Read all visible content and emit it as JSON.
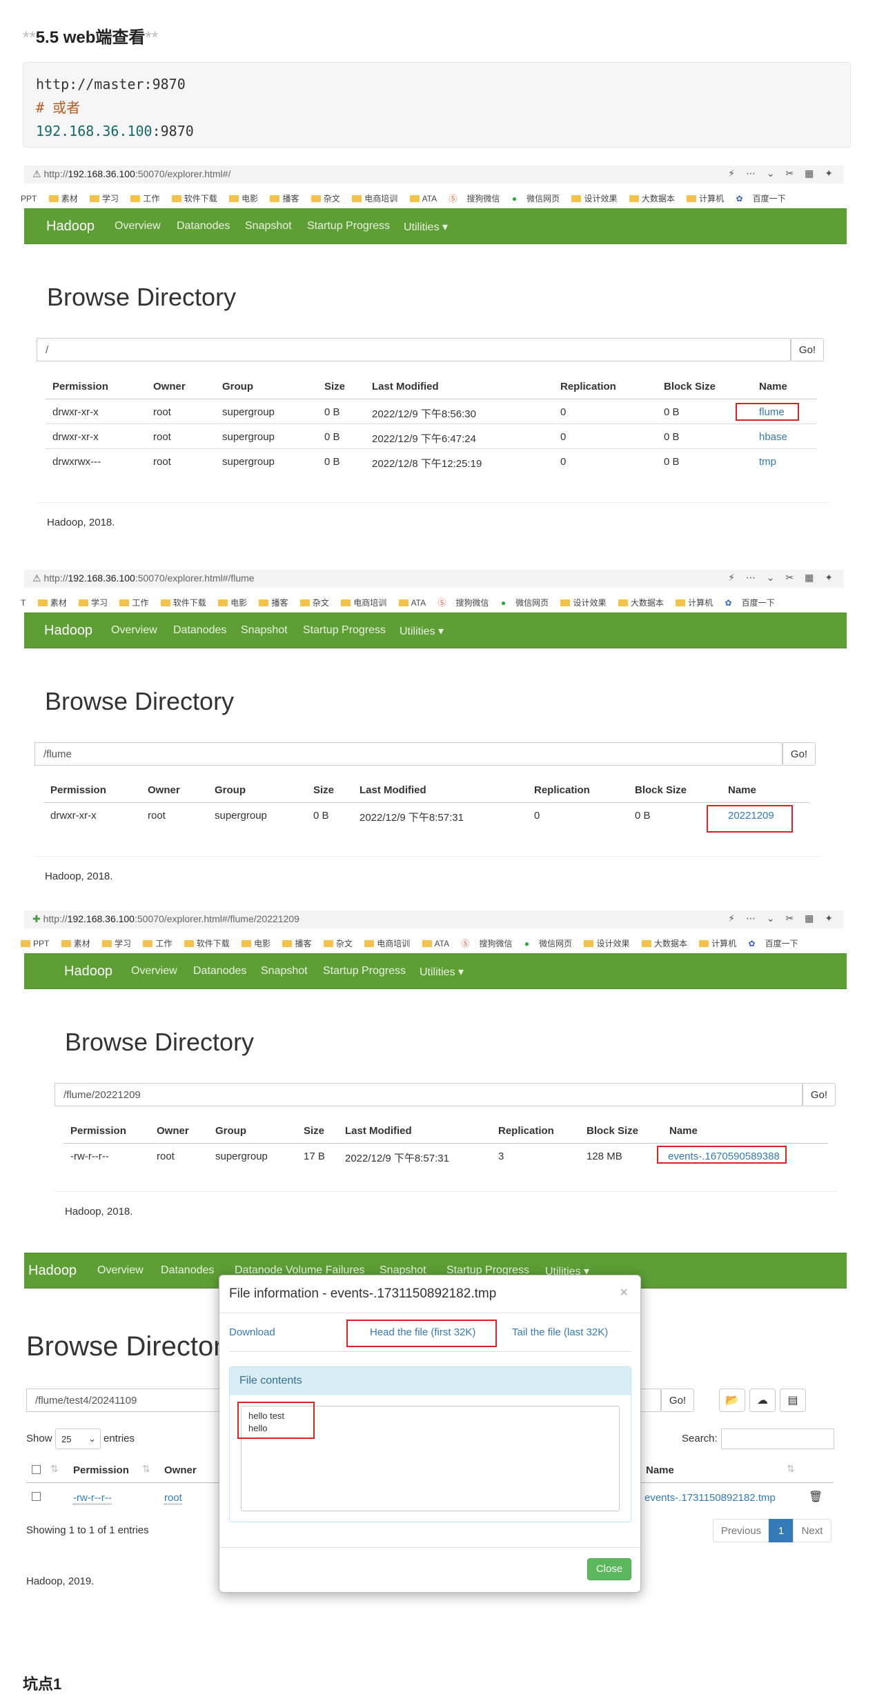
{
  "heading": {
    "stars": "**",
    "text": "5.5 web端查看"
  },
  "code": {
    "line1": "http://master:9870",
    "line2": "# 或者",
    "line3_num": "192.168.36.100",
    "line3_rest": ":9870"
  },
  "bookmarks": [
    "PPT",
    "素材",
    "学习",
    "工作",
    "软件下载",
    "电影",
    "播客",
    "杂文",
    "电商培训",
    "ATA",
    "搜狗微信",
    "微信网页",
    "设计效果",
    "大数据本",
    "计算机",
    "百度一下"
  ],
  "shots": [
    {
      "url_pre": "http://",
      "url_host": "192.168.36.100",
      "url_rest": ":50070/explorer.html#/",
      "nav": {
        "brand": "Hadoop",
        "items": [
          "Overview",
          "Datanodes",
          "Snapshot",
          "Startup Progress",
          "Utilities ▾"
        ]
      },
      "title": "Browse Directory",
      "path": "/",
      "go": "Go!",
      "headers": [
        "Permission",
        "Owner",
        "Group",
        "Size",
        "Last Modified",
        "Replication",
        "Block Size",
        "Name"
      ],
      "rows": [
        [
          "drwxr-xr-x",
          "root",
          "supergroup",
          "0 B",
          "2022/12/9 下午8:56:30",
          "0",
          "0 B",
          "flume"
        ],
        [
          "drwxr-xr-x",
          "root",
          "supergroup",
          "0 B",
          "2022/12/9 下午6:47:24",
          "0",
          "0 B",
          "hbase"
        ],
        [
          "drwxrwx---",
          "root",
          "supergroup",
          "0 B",
          "2022/12/8 下午12:25:19",
          "0",
          "0 B",
          "tmp"
        ]
      ],
      "footer": "Hadoop, 2018."
    },
    {
      "url_pre": "http://",
      "url_host": "192.168.36.100",
      "url_rest": ":50070/explorer.html#/flume",
      "nav": {
        "brand": "Hadoop",
        "items": [
          "Overview",
          "Datanodes",
          "Snapshot",
          "Startup Progress",
          "Utilities ▾"
        ]
      },
      "title": "Browse Directory",
      "path": "/flume",
      "go": "Go!",
      "headers": [
        "Permission",
        "Owner",
        "Group",
        "Size",
        "Last Modified",
        "Replication",
        "Block Size",
        "Name"
      ],
      "rows": [
        [
          "drwxr-xr-x",
          "root",
          "supergroup",
          "0 B",
          "2022/12/9 下午8:57:31",
          "0",
          "0 B",
          "20221209"
        ]
      ],
      "footer": "Hadoop, 2018."
    },
    {
      "url_pre": "http://",
      "url_host": "192.168.36.100",
      "url_rest": ":50070/explorer.html#/flume/20221209",
      "nav": {
        "brand": "Hadoop",
        "items": [
          "Overview",
          "Datanodes",
          "Snapshot",
          "Startup Progress",
          "Utilities ▾"
        ]
      },
      "title": "Browse Directory",
      "path": "/flume/20221209",
      "go": "Go!",
      "headers": [
        "Permission",
        "Owner",
        "Group",
        "Size",
        "Last Modified",
        "Replication",
        "Block Size",
        "Name"
      ],
      "rows": [
        [
          "-rw-r--r--",
          "root",
          "supergroup",
          "17 B",
          "2022/12/9 下午8:57:31",
          "3",
          "128 MB",
          "events-.1670590589388"
        ]
      ],
      "footer": "Hadoop, 2018."
    }
  ],
  "shot4": {
    "nav": {
      "brand": "Hadoop",
      "items": [
        "Overview",
        "Datanodes",
        "Datanode Volume Failures",
        "Snapshot",
        "Startup Progress",
        "Utilities ▾"
      ]
    },
    "title": "Browse Directory",
    "path": "/flume/test4/20241109",
    "go": "Go!",
    "show": "Show",
    "entries_value": "25",
    "entries": "entries",
    "search_label": "Search:",
    "headers": {
      "permission": "Permission",
      "owner": "Owner",
      "name": "Name"
    },
    "row": {
      "permission": "-rw-r--r--",
      "owner": "root",
      "name": "events-.1731150892182.tmp"
    },
    "showing": "Showing 1 to 1 of 1 entries",
    "pager": {
      "previous": "Previous",
      "page": "1",
      "next": "Next"
    },
    "footer": "Hadoop, 2019.",
    "modal": {
      "title": "File information - events-.1731150892182.tmp",
      "close_x": "×",
      "download": "Download",
      "head": "Head the file (first 32K)",
      "tail": "Tail the file (last 32K)",
      "panel_title": "File contents",
      "contents": "hello test\nhello",
      "close": "Close"
    }
  },
  "pitfall": "坑点1",
  "colors": {
    "hadoop_green": "#5d9f35",
    "link": "#337ab7",
    "highlight_red": "#e02020"
  }
}
